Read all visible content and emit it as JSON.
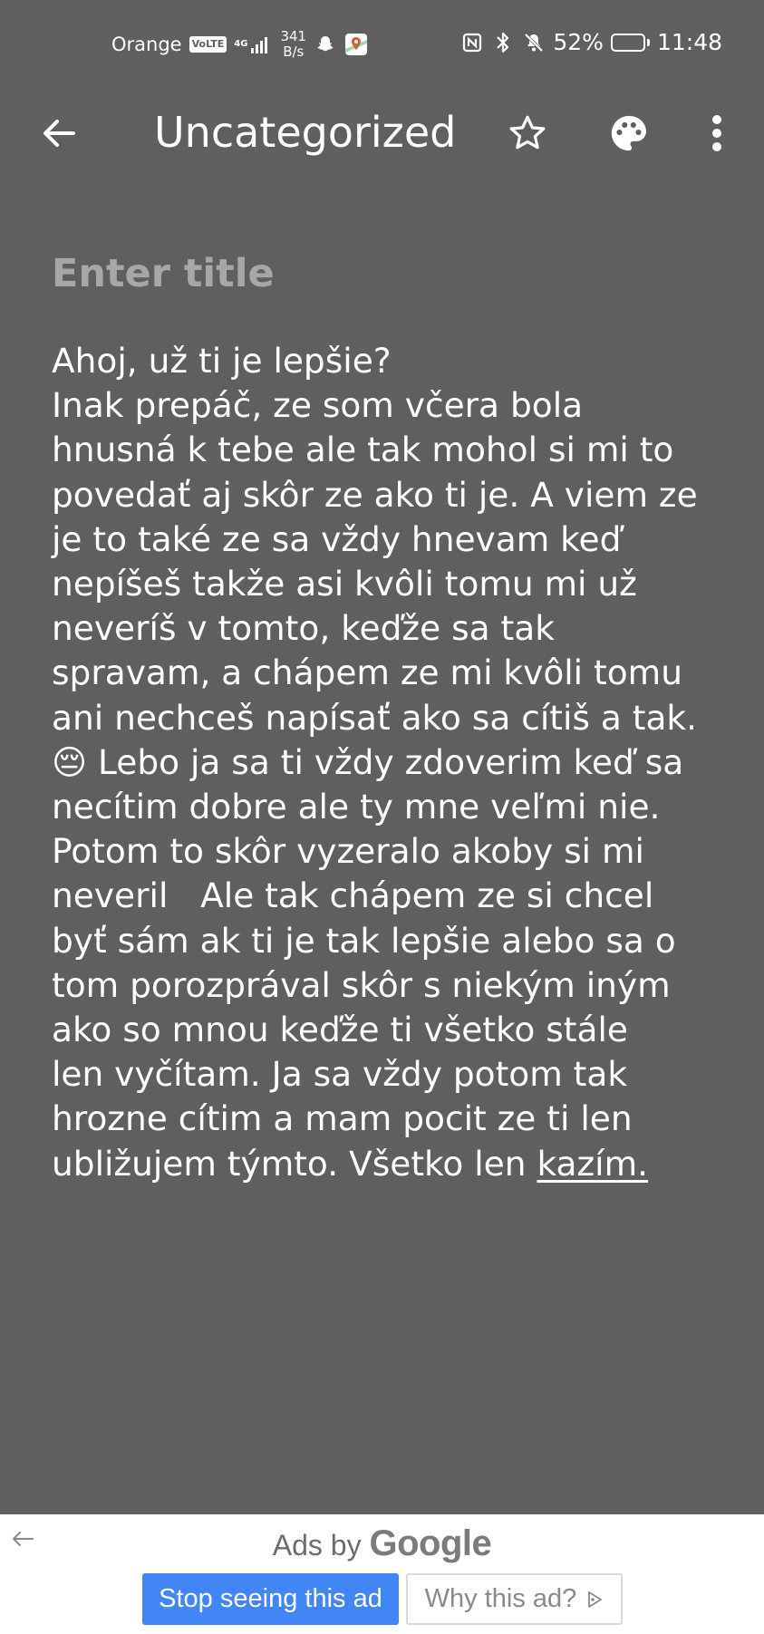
{
  "status_bar": {
    "carrier": "Orange",
    "volte_badge": "VoLTE",
    "network_type": "4G",
    "data_rate_value": "341",
    "data_rate_unit": "B/s",
    "battery_percent": "52%",
    "battery_level": 0.52,
    "time": "11:48",
    "icons": [
      "signal-icon",
      "snapchat-icon",
      "maps-icon",
      "nfc-icon",
      "bluetooth-icon",
      "mute-icon",
      "battery-icon"
    ]
  },
  "app_bar": {
    "title": "Uncategorized",
    "icons": [
      "back-arrow-icon",
      "star-icon",
      "palette-icon",
      "more-vert-icon"
    ]
  },
  "note": {
    "title_placeholder": "Enter title",
    "title_value": "",
    "body_lines": [
      "Ahoj, už ti je lepšie?",
      "Inak prepáč, ze som včera bola",
      "hnusná k tebe ale tak mohol si mi to",
      "povedať aj skôr ze ako ti je. A viem ze",
      "je to také ze sa vždy hnevam keď",
      "nepíšeš takže asi kvôli tomu mi už",
      "neveríš v tomto, keďže sa tak",
      "spravam, a chápem ze mi kvôli tomu",
      "ani nechceš napísať ako sa cítiš a tak.",
      "😔 Lebo ja sa ti vždy zdoverim keď sa",
      "necítim dobre ale ty mne veľmi nie.",
      "Potom to skôr vyzeralo akoby si mi",
      "neveril   Ale tak chápem ze si chcel",
      "byť sám ak ti je tak lepšie alebo sa o",
      "tom porozprával skôr s niekým iným",
      "ako so mnou keďže ti všetko stále",
      "len vyčítam. Ja sa vždy potom tak",
      "hrozne cítim a mam pocit ze ti len",
      "ubližujem týmto. Všetko len "
    ],
    "body_last_word": "kazím."
  },
  "ad": {
    "ads_by": "Ads by",
    "brand": "Google",
    "stop_label": "Stop seeing this ad",
    "why_label": "Why this ad?",
    "icons": [
      "ad-back-icon",
      "adchoices-icon"
    ]
  },
  "colors": {
    "background": "#5f5f5f",
    "text": "#ffffff",
    "placeholder": "#a7a7a7",
    "ad_button_blue": "#4285f4"
  }
}
